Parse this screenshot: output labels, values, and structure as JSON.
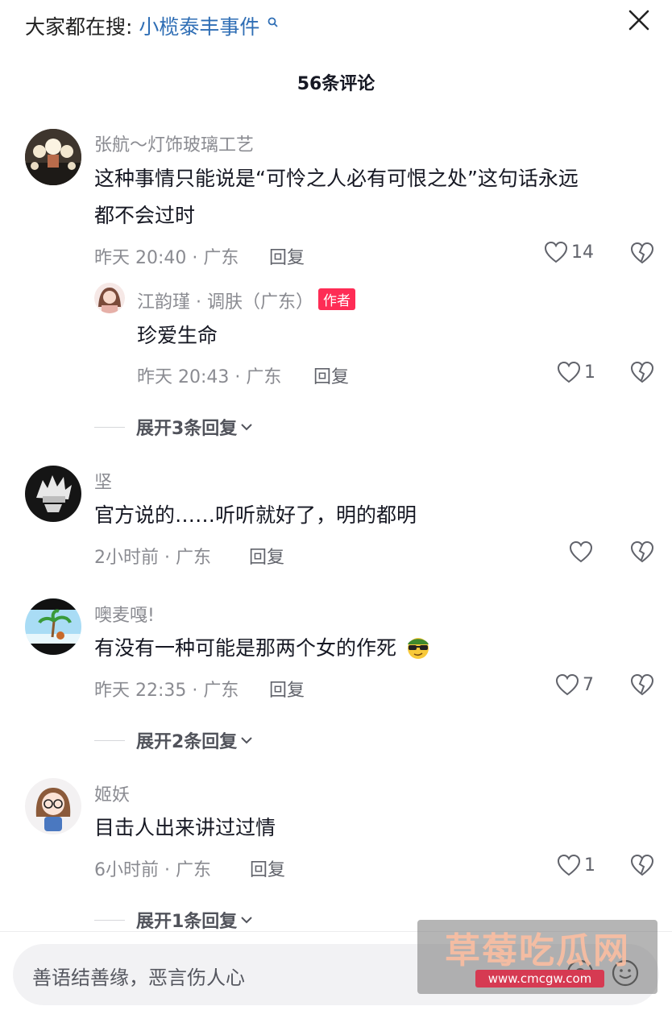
{
  "header": {
    "search_prefix": "大家都在搜:",
    "search_query": "小榄泰丰事件",
    "comment_count": "56条评论"
  },
  "comments": [
    {
      "user": "张航～灯饰玻璃工艺",
      "text_line1": "这种事情只能说是“可怜之人必有可恨之处”这句话永远",
      "text_line2": "都不会过时",
      "meta": "昨天 20:40 · 广东",
      "reply_label": "回复",
      "likes": "14",
      "reply": {
        "user": "江韵瑾 · 调肤（广东）",
        "badge": "作者",
        "text": "珍爱生命",
        "meta": "昨天 20:43 · 广东",
        "reply_label": "回复",
        "likes": "1"
      },
      "expand": "展开3条回复"
    },
    {
      "user": "坚",
      "text": "官方说的……听听就好了，明的都明",
      "meta": "2小时前 · 广东",
      "reply_label": "回复",
      "likes": ""
    },
    {
      "user": "噢麦嘎!",
      "text": "有没有一种可能是那两个女的作死",
      "emoji": "😎",
      "meta": "昨天 22:35 · 广东",
      "reply_label": "回复",
      "likes": "7",
      "expand": "展开2条回复"
    },
    {
      "user": "姬妖",
      "text": "目击人出来讲过过情",
      "meta": "6小时前 · 广东",
      "reply_label": "回复",
      "likes": "1",
      "expand": "展开1条回复"
    }
  ],
  "input": {
    "placeholder": "善语结善缘，恶言伤人心"
  },
  "watermark": {
    "title": "草莓吃瓜网",
    "url": "www.cmcgw.com"
  },
  "colors": {
    "link": "#2f6eb5",
    "author_badge": "#fe2c55",
    "secondary_text": "#8a8b91"
  }
}
